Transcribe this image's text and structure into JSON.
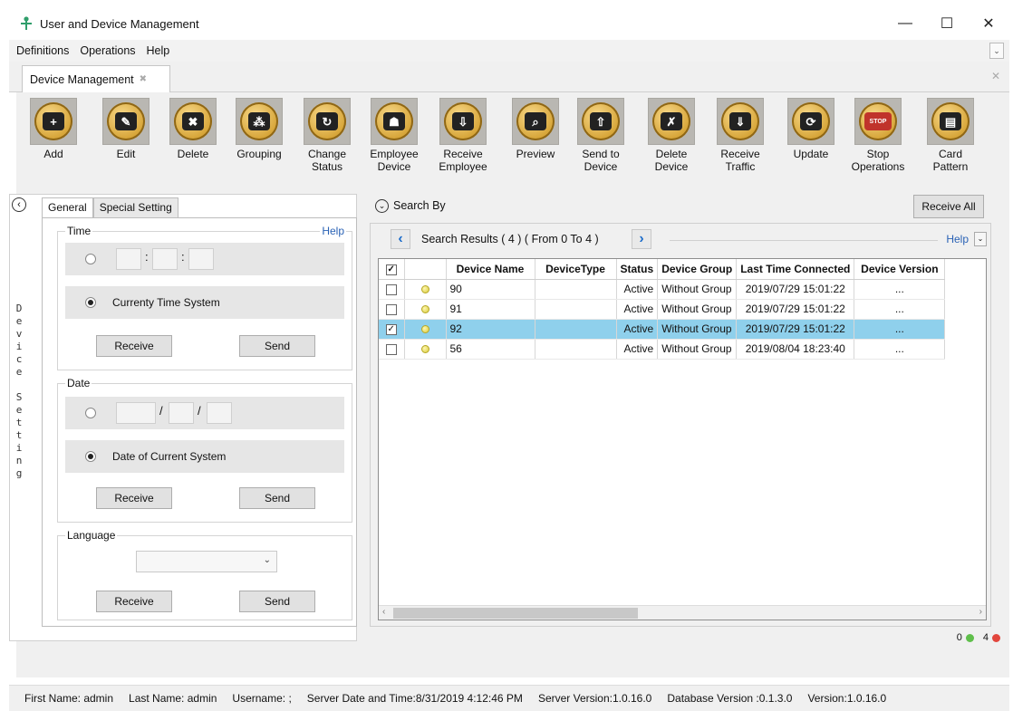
{
  "window": {
    "title": "User and Device Management",
    "controls": [
      "—",
      "☐",
      "✕"
    ]
  },
  "menu": [
    "Definitions",
    "Operations",
    "Help"
  ],
  "tab": {
    "label": "Device Management"
  },
  "toolbar": [
    {
      "label": "Add",
      "icon": "add-icon",
      "glyph": "+"
    },
    {
      "label": "Edit",
      "icon": "edit-icon",
      "glyph": "✎"
    },
    {
      "label": "Delete",
      "icon": "delete-icon",
      "glyph": "✖"
    },
    {
      "label": "Grouping",
      "icon": "grouping-icon",
      "glyph": "⁂"
    },
    {
      "label": "Change Status",
      "icon": "change-status-icon",
      "glyph": "↻"
    },
    {
      "label": "Employee Device",
      "icon": "employee-device-icon",
      "glyph": "☗"
    },
    {
      "label": "Receive Employee",
      "icon": "receive-employee-icon",
      "glyph": "⇩"
    },
    {
      "label": "Preview",
      "icon": "preview-icon",
      "glyph": "⌕"
    },
    {
      "label": "Send to Device",
      "icon": "send-to-device-icon",
      "glyph": "⇧"
    },
    {
      "label": "Delete Device",
      "icon": "delete-device-icon",
      "glyph": "✗"
    },
    {
      "label": "Receive Traffic",
      "icon": "receive-traffic-icon",
      "glyph": "⇓"
    },
    {
      "label": "Update",
      "icon": "update-icon",
      "glyph": "⟳"
    },
    {
      "label": "Stop Operations",
      "icon": "stop-icon",
      "glyph": "STOP"
    },
    {
      "label": "Card Pattern",
      "icon": "card-pattern-icon",
      "glyph": "▤"
    }
  ],
  "left": {
    "vertical_label": "Device Setting",
    "tabs": [
      "General",
      "Special Setting"
    ],
    "time": {
      "title": "Time",
      "help": "Help",
      "radio_label": "Currenty Time System",
      "receive": "Receive",
      "send": "Send"
    },
    "date": {
      "title": "Date",
      "radio_label": "Date of Current System",
      "receive": "Receive",
      "send": "Send"
    },
    "language": {
      "title": "Language",
      "receive": "Receive",
      "send": "Send"
    }
  },
  "right": {
    "search_by": "Search By",
    "receive_all": "Receive All",
    "results_text": "Search Results ( 4 ) ( From 0 To 4 )",
    "help": "Help",
    "columns": [
      "Device Name",
      "DeviceType",
      "Status",
      "Device Group",
      "Last Time Connected",
      "Device Version"
    ],
    "rows": [
      {
        "name": "90",
        "type": "",
        "status": "Active",
        "group": "Without Group",
        "last": "2019/07/29 15:01:22",
        "version": "...",
        "checked": false,
        "selected": false
      },
      {
        "name": "91",
        "type": "",
        "status": "Active",
        "group": "Without Group",
        "last": "2019/07/29 15:01:22",
        "version": "...",
        "checked": false,
        "selected": false
      },
      {
        "name": "92",
        "type": "",
        "status": "Active",
        "group": "Without Group",
        "last": "2019/07/29 15:01:22",
        "version": "...",
        "checked": true,
        "selected": true
      },
      {
        "name": "56",
        "type": "",
        "status": "Active",
        "group": "Without Group",
        "last": "2019/08/04 18:23:40",
        "version": "...",
        "checked": false,
        "selected": false
      }
    ],
    "online_count": "0",
    "offline_count": "4",
    "colors": {
      "online": "#5fbf4b",
      "offline": "#e2463d",
      "selected_row": "#8fd0ec"
    }
  },
  "status": {
    "first_name": "First Name: admin",
    "last_name": "Last Name: admin",
    "username": "Username: ;",
    "server_time": "Server Date and Time:8/31/2019 4:12:46 PM",
    "server_version": "Server Version:1.0.16.0",
    "db_version": "Database Version :0.1.3.0",
    "version": "Version:1.0.16.0"
  }
}
